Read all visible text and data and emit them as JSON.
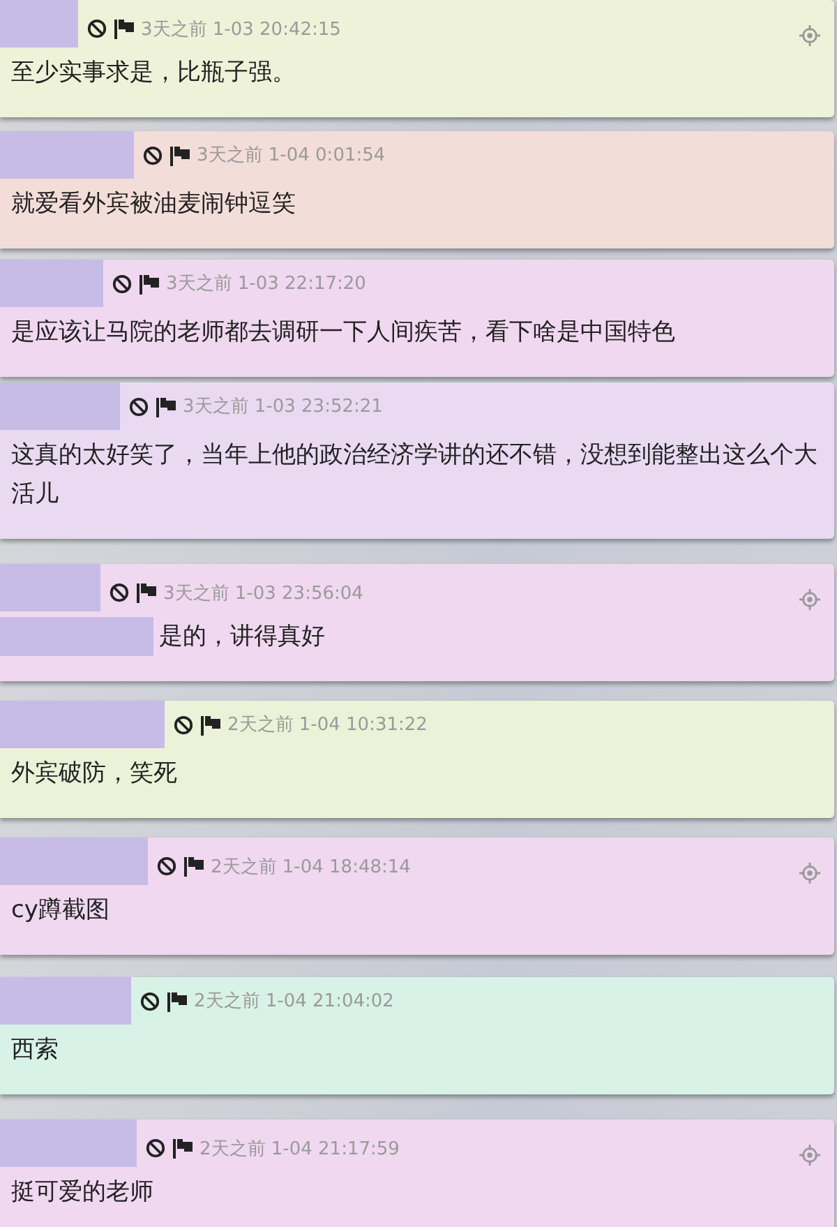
{
  "comments": [
    {
      "color": "#eef2d8",
      "time": "3天之前 1-03 20:42:15",
      "text": "至少实事求是，比瓶子强。",
      "locate": true,
      "quote_redacted": false
    },
    {
      "color": "#f3ddd8",
      "time": "3天之前 1-04 0:01:54",
      "text": "就爱看外宾被油麦闹钟逗笑",
      "locate": false,
      "quote_redacted": false
    },
    {
      "color": "#f0d8f1",
      "time": "3天之前 1-03 22:17:20",
      "text": "是应该让马院的老师都去调研一下人间疾苦，看下啥是中国特色",
      "locate": false,
      "quote_redacted": false
    },
    {
      "color": "#e9daf2",
      "time": "3天之前 1-03 23:52:21",
      "text": "这真的太好笑了，当年上他的政治经济学讲的还不错，没想到能整出这么个大活儿",
      "locate": false,
      "quote_redacted": false
    },
    {
      "color": "#f0d8f1",
      "time": "3天之前 1-03 23:56:04",
      "text": "是的，讲得真好",
      "locate": true,
      "quote_redacted": true
    },
    {
      "color": "#ecf2d8",
      "time": "2天之前 1-04 10:31:22",
      "text": "外宾破防，笑死",
      "locate": false,
      "quote_redacted": false
    },
    {
      "color": "#f0d8f1",
      "time": "2天之前 1-04 18:48:14",
      "text": "cy蹲截图",
      "locate": true,
      "quote_redacted": false
    },
    {
      "color": "#d8f2e8",
      "time": "2天之前 1-04 21:04:02",
      "text": "西索",
      "locate": false,
      "quote_redacted": false
    },
    {
      "color": "#f0d8f1",
      "time": "2天之前 1-04 21:17:59",
      "text": "挺可爱的老师",
      "locate": true,
      "quote_redacted": false
    }
  ]
}
